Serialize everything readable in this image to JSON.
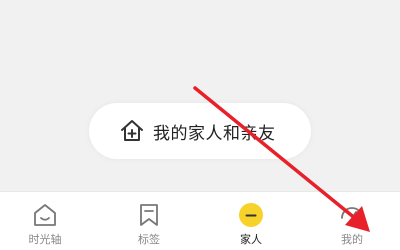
{
  "main": {
    "family_button_label": "我的家人和亲友",
    "family_button_icon": "house-plus-icon"
  },
  "tabbar": {
    "tabs": [
      {
        "label": "时光轴",
        "icon": "timeline-face-icon",
        "active": false
      },
      {
        "label": "标签",
        "icon": "bookmark-tag-icon",
        "active": false
      },
      {
        "label": "家人",
        "icon": "family-circle-icon",
        "active": true
      },
      {
        "label": "我的",
        "icon": "profile-icon",
        "active": false
      }
    ]
  },
  "colors": {
    "accent": "#f7d22a",
    "annotation_arrow": "#e8202a",
    "background": "#f1f1f1"
  }
}
